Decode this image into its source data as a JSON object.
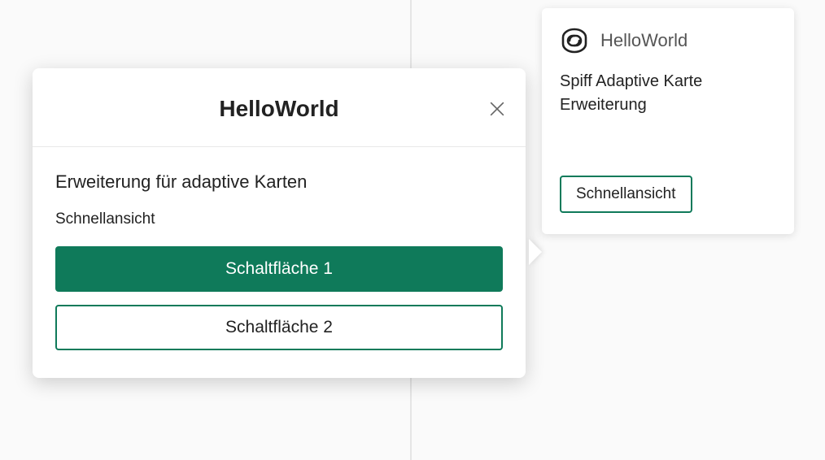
{
  "card": {
    "title": "HelloWorld",
    "description": "Spiff Adaptive Karte  Erweiterung",
    "button_label": "Schnellansicht"
  },
  "modal": {
    "title": "HelloWorld",
    "heading": "Erweiterung für adaptive Karten",
    "sub": "Schnellansicht",
    "button1_label": "Schaltfläche 1",
    "button2_label": "Schaltfläche 2"
  },
  "colors": {
    "accent": "#0f7a5a"
  }
}
